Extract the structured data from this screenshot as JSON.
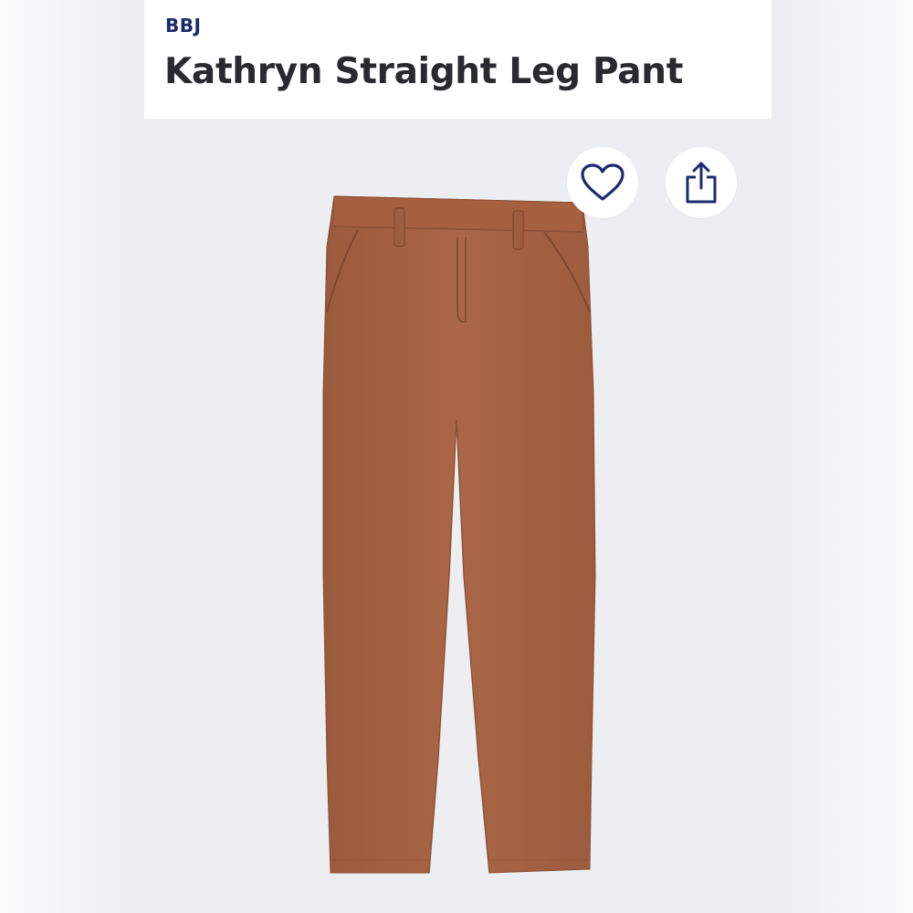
{
  "product": {
    "brand": "BBJ",
    "title": "Kathryn Straight Leg Pant"
  },
  "actions": {
    "favorite_icon": "heart-icon",
    "share_icon": "share-icon"
  },
  "colors": {
    "brand_text": "#1a2a6b",
    "title_text": "#2a2a2e",
    "icon_stroke": "#1c2b6e",
    "photo_background": "#eceef1",
    "garment": "#a86444"
  }
}
